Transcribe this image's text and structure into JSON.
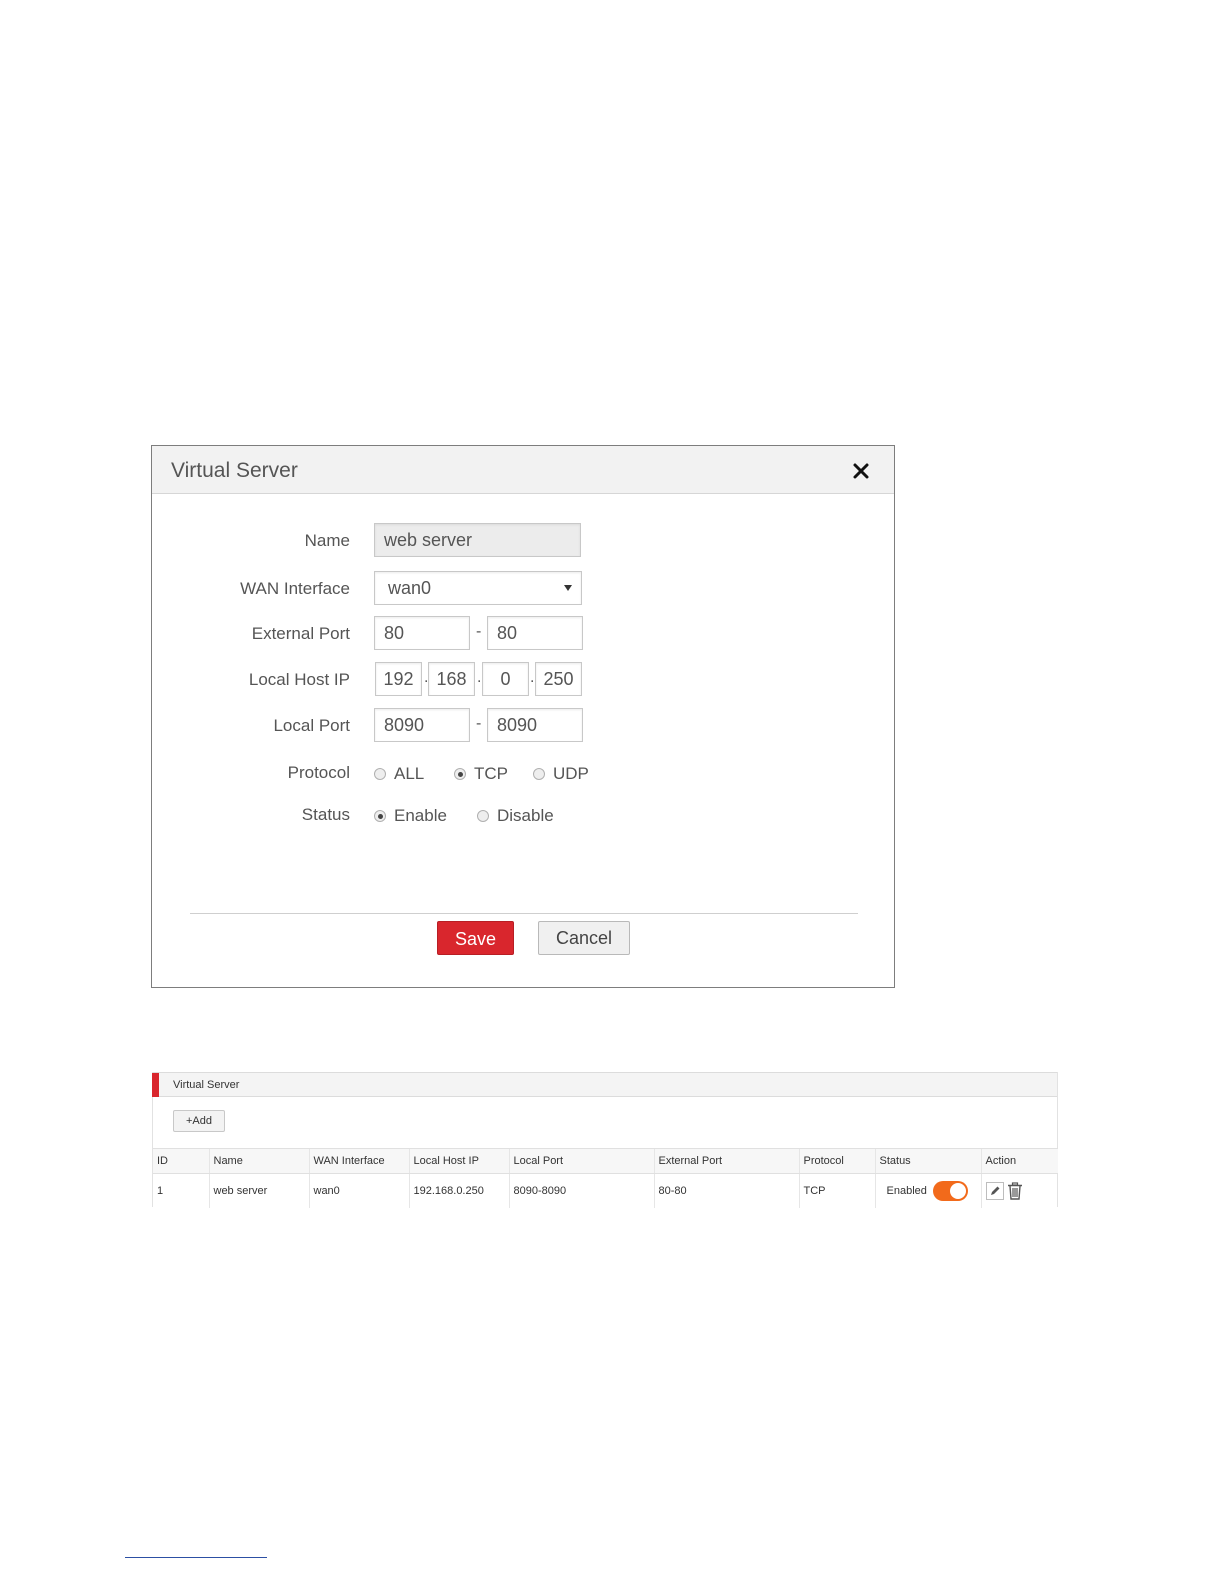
{
  "dialog": {
    "title": "Virtual Server",
    "fields": {
      "name": {
        "label": "Name",
        "value": "web server"
      },
      "wan_interface": {
        "label": "WAN Interface",
        "value": "wan0"
      },
      "external_port": {
        "label": "External Port",
        "from": "80",
        "to": "80"
      },
      "local_host_ip": {
        "label": "Local Host IP",
        "octets": [
          "192",
          "168",
          "0",
          "250"
        ]
      },
      "local_port": {
        "label": "Local Port",
        "from": "8090",
        "to": "8090"
      },
      "protocol": {
        "label": "Protocol",
        "options": [
          "ALL",
          "TCP",
          "UDP"
        ],
        "selected": "TCP"
      },
      "status": {
        "label": "Status",
        "options": [
          "Enable",
          "Disable"
        ],
        "selected": "Enable"
      }
    },
    "save_label": "Save",
    "cancel_label": "Cancel",
    "range_separator": "-",
    "ip_separator": "."
  },
  "panel": {
    "title": "Virtual Server",
    "add_label": "+Add",
    "accent_color": "#d9262d",
    "columns": [
      "ID",
      "Name",
      "WAN Interface",
      "Local Host IP",
      "Local Port",
      "External Port",
      "Protocol",
      "Status",
      "Action"
    ],
    "rows": [
      {
        "id": "1",
        "name": "web server",
        "wan_interface": "wan0",
        "local_host_ip": "192.168.0.250",
        "local_port": "8090-8090",
        "external_port": "80-80",
        "protocol": "TCP",
        "status": "Enabled",
        "toggle_on": true
      }
    ]
  },
  "colors": {
    "save_button": "#d9262d",
    "toggle_on": "#f26a1b"
  }
}
